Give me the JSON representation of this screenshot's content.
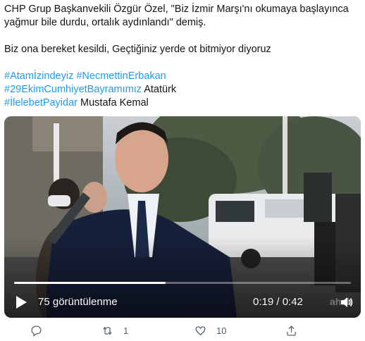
{
  "tweet": {
    "line1": "CHP Grup Başkanvekili Özgür Özel, \"Biz İzmir Marşı'nı okumaya başlayınca",
    "line2": "yağmur bile durdu, ortalık aydınlandı\" demiş.",
    "line3": "Biz ona bereket kesildi, Geçtiğiniz yerde ot bitmiyor diyoruz",
    "hashtag1": "#Atamİzindeyiz",
    "hashtag2": "#NecmettinErbakan",
    "hashtag3": "#29EkimCumhiyetBayramımız",
    "text_after_hashtag3": "Atatürk",
    "hashtag4": "#İlelebetPayidar",
    "text_after_hashtag4": "Mustafa Kemal"
  },
  "video": {
    "views": "75 görüntülenme",
    "time": "0:19 / 0:42",
    "progress": 0.45,
    "watermark": "ahab"
  },
  "actions": {
    "retweets": "1",
    "likes": "10"
  },
  "colors": {
    "hashtag": "#1d9bf0",
    "text": "#0f1419",
    "muted": "#536471"
  }
}
